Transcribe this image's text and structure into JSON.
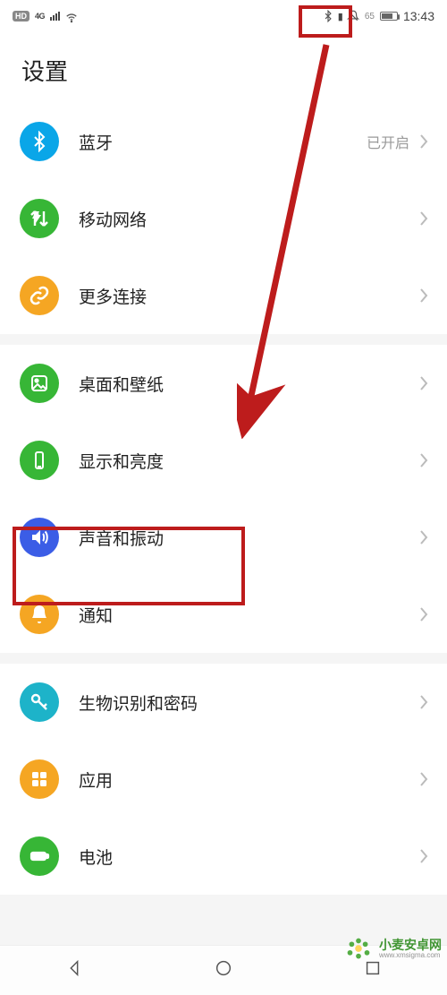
{
  "status_bar": {
    "hd": "HD",
    "net": "4G",
    "battery_pct": "65",
    "time": "13:43"
  },
  "header": {
    "title": "设置"
  },
  "section1": {
    "bluetooth": {
      "label": "蓝牙",
      "value": "已开启"
    },
    "mobile_network": {
      "label": "移动网络"
    },
    "more_connections": {
      "label": "更多连接"
    }
  },
  "section2": {
    "wallpaper": {
      "label": "桌面和壁纸"
    },
    "display": {
      "label": "显示和亮度"
    },
    "sound": {
      "label": "声音和振动"
    },
    "notifications": {
      "label": "通知"
    }
  },
  "section3": {
    "biometrics": {
      "label": "生物识别和密码"
    },
    "apps": {
      "label": "应用"
    },
    "battery": {
      "label": "电池"
    }
  },
  "watermark": {
    "cn": "小麦安卓网",
    "en": "www.xmsigma.com"
  }
}
